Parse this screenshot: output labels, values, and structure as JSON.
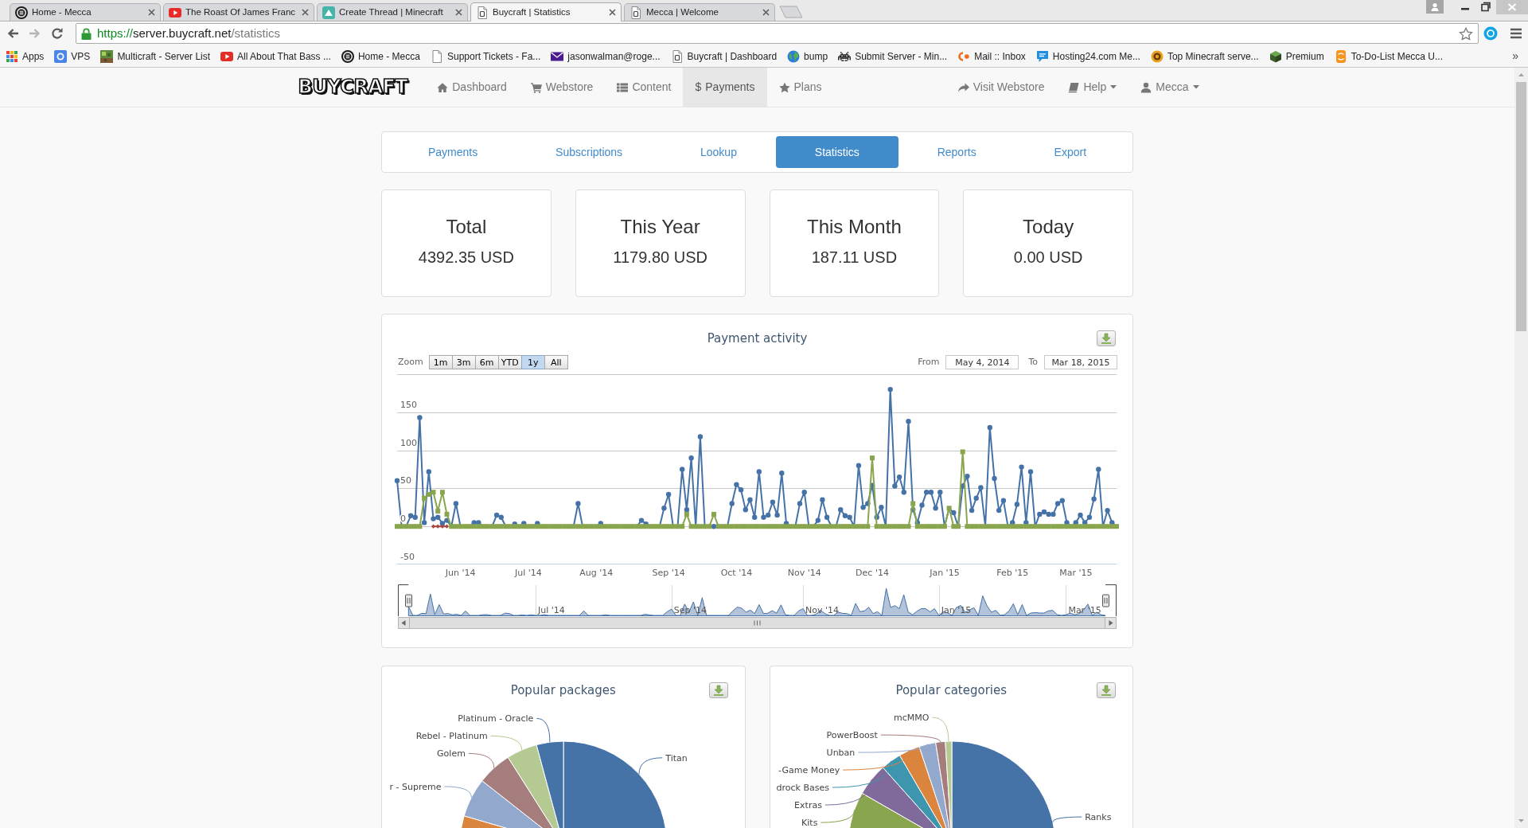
{
  "browser": {
    "tabs": [
      {
        "title": "Home - Mecca",
        "selected": false
      },
      {
        "title": "The Roast Of James Franc",
        "selected": false
      },
      {
        "title": "Create Thread | Minecraft",
        "selected": false
      },
      {
        "title": "Buycraft | Statistics",
        "selected": true
      },
      {
        "title": "Mecca | Welcome",
        "selected": false
      }
    ],
    "address_bar": {
      "scheme": "https://",
      "host": "server.buycraft.net",
      "path": "/statistics"
    },
    "bookmarks": [
      "Apps",
      "VPS",
      "Multicraft - Server List",
      "All About That Bass ...",
      "Home - Mecca",
      "Support Tickets - Fa...",
      "jasonwalman@roge...",
      "Buycraft | Dashboard",
      "bump",
      "Submit Server - Min...",
      "Mail :: Inbox",
      "Hosting24.com Me...",
      "Top Minecraft serve...",
      "Premium",
      "To-Do-List Mecca U..."
    ],
    "bookmarks_overflow": "»"
  },
  "navbar": {
    "logo": "BUYCRAFT",
    "items": [
      {
        "label": "Dashboard",
        "selected": false
      },
      {
        "label": "Webstore",
        "selected": false
      },
      {
        "label": "Content",
        "selected": false
      },
      {
        "label": "Payments",
        "glyph": "$",
        "selected": true
      },
      {
        "label": "Plans",
        "selected": false
      }
    ],
    "right_items": [
      {
        "label": "Visit Webstore",
        "dropdown": false
      },
      {
        "label": "Help",
        "dropdown": true
      },
      {
        "label": "Mecca",
        "dropdown": true
      }
    ]
  },
  "subnav": [
    {
      "label": "Payments",
      "selected": false
    },
    {
      "label": "Subscriptions",
      "selected": false
    },
    {
      "label": "Lookup",
      "selected": false
    },
    {
      "label": "Statistics",
      "selected": true
    },
    {
      "label": "Reports",
      "selected": false
    },
    {
      "label": "Export",
      "selected": false
    }
  ],
  "stats": [
    {
      "title": "Total",
      "value": "4392.35 USD"
    },
    {
      "title": "This Year",
      "value": "1179.80 USD"
    },
    {
      "title": "This Month",
      "value": "187.11 USD"
    },
    {
      "title": "Today",
      "value": "0.00 USD"
    }
  ],
  "payment_activity": {
    "zoom_label": "Zoom",
    "zoom_buttons": [
      {
        "label": "1m",
        "selected": false
      },
      {
        "label": "3m",
        "selected": false
      },
      {
        "label": "6m",
        "selected": false
      },
      {
        "label": "YTD",
        "selected": false
      },
      {
        "label": "1y",
        "selected": true
      },
      {
        "label": "All",
        "selected": false
      }
    ],
    "from_label": "From",
    "from_value": "May 4, 2014",
    "to_label": "To",
    "to_value": "Mar 18, 2015",
    "chart_data": {
      "type": "line",
      "title": "Payment activity",
      "categories": [
        null,
        null,
        null,
        null,
        null,
        null,
        null,
        null,
        null,
        null,
        null,
        null,
        null,
        null,
        "Jun '14",
        null,
        null,
        null,
        null,
        null,
        null,
        null,
        null,
        null,
        null,
        null,
        null,
        null,
        null,
        "Jul '14",
        null,
        null,
        null,
        null,
        null,
        null,
        null,
        null,
        null,
        null,
        null,
        null,
        null,
        null,
        "Aug '14",
        null,
        null,
        null,
        null,
        null,
        null,
        null,
        null,
        null,
        null,
        null,
        null,
        null,
        null,
        null,
        "Sep '14",
        null,
        null,
        null,
        null,
        null,
        null,
        null,
        null,
        null,
        null,
        null,
        null,
        null,
        null,
        "Oct '14",
        null,
        null,
        null,
        null,
        null,
        null,
        null,
        null,
        null,
        null,
        null,
        null,
        null,
        null,
        "Nov '14",
        null,
        null,
        null,
        null,
        null,
        null,
        null,
        null,
        null,
        null,
        null,
        null,
        null,
        null,
        "Dec '14",
        null,
        null,
        null,
        null,
        null,
        null,
        null,
        null,
        null,
        null,
        null,
        null,
        null,
        null,
        null,
        "Jan '15",
        null,
        null,
        null,
        null,
        null,
        null,
        null,
        null,
        null,
        null,
        null,
        null,
        null,
        null,
        "Feb '15",
        null,
        null,
        null,
        null,
        null,
        null,
        null,
        null,
        null,
        null,
        null,
        null,
        null,
        "Mar '15",
        null,
        null,
        null,
        null,
        null,
        null,
        null,
        null,
        null
      ],
      "ylim": [
        -50,
        200
      ],
      "yticks": [
        -50,
        0,
        50,
        100,
        150
      ],
      "grid": true,
      "series": [
        {
          "color": "#4572a7",
          "marker": "circle",
          "values": [
            60,
            0,
            0,
            14,
            12,
            143,
            5,
            72,
            10,
            12,
            4,
            8,
            0,
            30,
            0,
            0,
            0,
            5,
            5,
            0,
            0,
            0,
            15,
            12,
            0,
            0,
            3,
            0,
            4,
            0,
            0,
            4,
            0,
            0,
            0,
            0,
            0,
            0,
            0,
            0,
            30,
            0,
            0,
            0,
            0,
            4,
            0,
            0,
            0,
            0,
            0,
            0,
            0,
            0,
            8,
            3,
            0,
            0,
            0,
            24,
            42,
            0,
            0,
            75,
            22,
            90,
            0,
            118,
            0,
            0,
            0,
            0,
            0,
            0,
            30,
            55,
            48,
            22,
            35,
            12,
            72,
            12,
            15,
            32,
            15,
            70,
            4,
            0,
            0,
            30,
            45,
            0,
            0,
            8,
            35,
            12,
            0,
            0,
            22,
            14,
            12,
            0,
            80,
            25,
            30,
            54,
            12,
            25,
            0,
            180,
            53,
            65,
            45,
            138,
            22,
            5,
            28,
            45,
            45,
            24,
            45,
            0,
            24,
            18,
            0,
            53,
            66,
            21,
            37,
            51,
            0,
            130,
            63,
            21,
            34,
            0,
            5,
            29,
            78,
            5,
            72,
            0,
            16,
            19,
            16,
            16,
            30,
            34,
            5,
            0,
            5,
            15,
            5,
            12,
            36,
            75,
            0,
            21,
            5,
            0
          ]
        },
        {
          "color": "#89a54e",
          "marker": "square",
          "values": [
            0,
            0,
            0,
            0,
            0,
            0,
            37,
            42,
            45,
            20,
            45,
            16,
            0,
            0,
            0,
            0,
            0,
            0,
            0,
            0,
            0,
            0,
            0,
            0,
            0,
            0,
            0,
            0,
            0,
            0,
            0,
            0,
            0,
            0,
            0,
            0,
            0,
            0,
            0,
            0,
            0,
            0,
            0,
            0,
            0,
            0,
            0,
            0,
            0,
            0,
            0,
            0,
            0,
            0,
            0,
            0,
            0,
            0,
            0,
            0,
            0,
            0,
            0,
            0,
            16,
            0,
            0,
            0,
            0,
            0,
            16,
            0,
            0,
            0,
            0,
            0,
            0,
            0,
            0,
            0,
            0,
            0,
            0,
            0,
            0,
            0,
            0,
            0,
            0,
            0,
            0,
            0,
            0,
            0,
            0,
            0,
            0,
            0,
            0,
            0,
            0,
            0,
            0,
            0,
            0,
            90,
            0,
            0,
            0,
            0,
            0,
            0,
            0,
            0,
            30,
            0,
            0,
            0,
            0,
            0,
            0,
            0,
            24,
            0,
            0,
            98,
            0,
            0,
            0,
            0,
            0,
            0,
            0,
            0,
            0,
            0,
            0,
            0,
            0,
            0,
            0,
            0,
            0,
            0,
            0,
            0,
            0,
            0,
            0,
            0,
            0,
            0,
            0,
            0,
            0,
            0,
            0,
            0,
            0,
            0
          ]
        },
        {
          "color": "#aa4643",
          "marker": "diamond",
          "values": [
            null,
            null,
            null,
            null,
            null,
            null,
            null,
            null,
            0,
            0,
            0,
            0,
            null,
            null,
            null,
            null,
            null,
            null,
            null,
            null,
            null,
            null,
            null,
            null,
            null,
            null,
            null,
            null,
            null,
            null,
            null,
            null,
            null,
            null,
            null,
            null,
            null,
            null,
            null,
            null,
            null,
            null,
            null,
            null,
            null,
            null,
            null,
            null,
            null,
            null,
            null,
            null,
            null,
            null,
            null,
            null,
            null,
            null,
            null,
            null,
            null,
            null,
            null,
            null,
            null,
            null,
            null,
            null,
            null,
            null,
            null,
            null,
            null,
            null,
            null,
            null,
            null,
            null,
            null,
            null,
            null,
            null,
            null,
            null,
            null,
            null,
            null,
            null,
            null,
            null,
            null,
            null,
            null,
            null,
            null,
            null,
            null,
            null,
            null,
            null,
            null,
            null,
            null,
            null,
            null,
            null,
            null,
            null,
            null,
            null,
            null,
            null,
            null,
            null,
            null,
            null,
            null,
            null,
            null,
            null,
            null,
            null,
            null,
            null,
            null,
            null,
            null,
            null,
            null,
            null,
            null,
            null,
            null,
            null,
            null,
            null,
            null,
            null,
            null,
            null,
            null,
            null,
            null,
            null,
            null,
            null,
            null,
            null,
            null,
            null,
            null,
            null,
            null,
            null,
            null,
            null,
            null,
            null,
            null,
            null
          ]
        }
      ]
    },
    "navigator": {
      "labels": [
        "Jul '14",
        "Sep '14",
        "Nov '14",
        "Jan '15",
        "Mar '15"
      ]
    }
  },
  "popular_packages": {
    "chart_data": {
      "type": "pie",
      "title": "Popular packages",
      "categories": [
        "Titan",
        null,
        "r - Supreme",
        "Golem",
        "Rebel - Platinum",
        "Platinum - Oracle"
      ],
      "values": [
        26.1,
        53.4,
        6.1,
        5.4,
        4.8,
        4.2
      ],
      "colors": [
        "#4572a7",
        "#db843d",
        "#92a8cd",
        "#a47d7c",
        "#b5ca92",
        "#4572a7"
      ]
    }
  },
  "popular_categories": {
    "chart_data": {
      "type": "pie",
      "title": "Popular categories",
      "categories": [
        "Ranks",
        "Kits",
        "Extras",
        "drock Bases",
        "-Game Money",
        "Unban",
        "PowerBoost",
        "mcMMO"
      ],
      "values": [
        43.0,
        40.3,
        5.1,
        3.2,
        3.3,
        2.6,
        1.5,
        1.0
      ],
      "colors": [
        "#4572a7",
        "#89a54e",
        "#80699b",
        "#3d96ae",
        "#db843d",
        "#92a8cd",
        "#a47d7c",
        "#b5ca92"
      ]
    }
  }
}
